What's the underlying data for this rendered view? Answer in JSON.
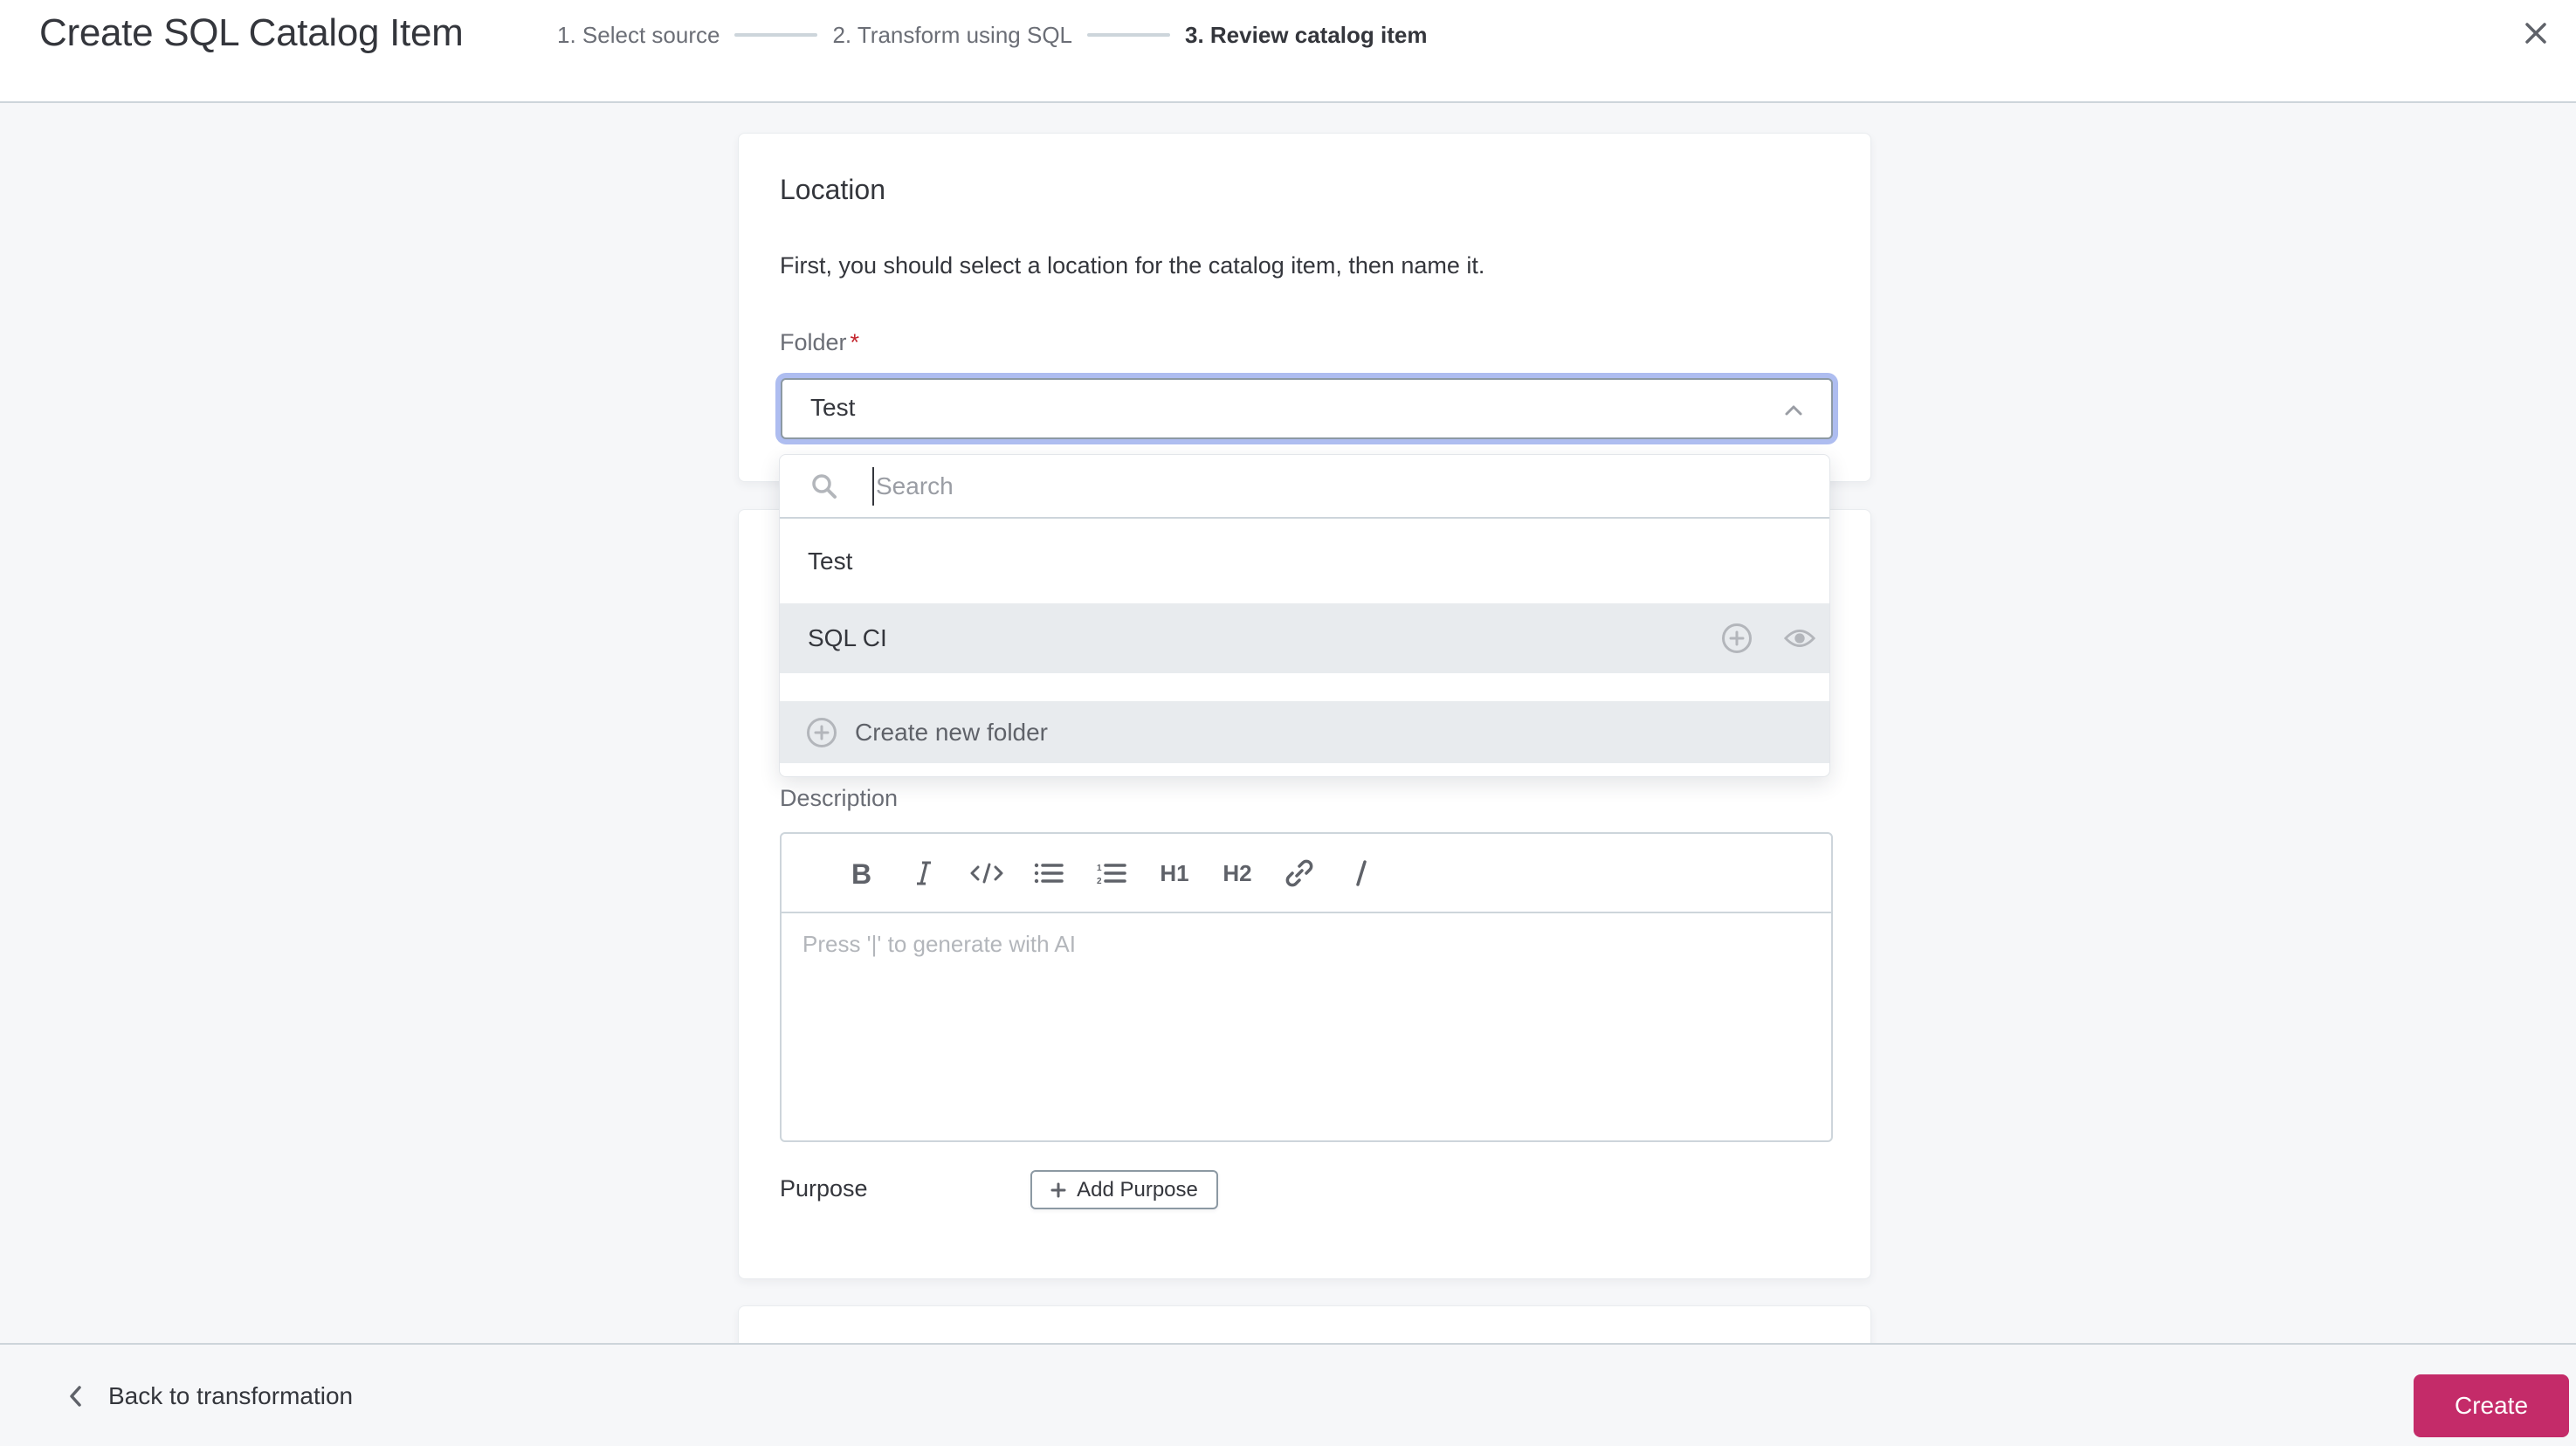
{
  "header": {
    "title": "Create SQL Catalog Item",
    "steps": [
      {
        "label": "1. Select source",
        "state": "completed"
      },
      {
        "label": "2. Transform using SQL",
        "state": "completed"
      },
      {
        "label": "3. Review catalog item",
        "state": "active"
      }
    ],
    "close_icon": "close-icon"
  },
  "location": {
    "title": "Location",
    "description": "First, you should select a location for the catalog item, then name it.",
    "folder_label": "Folder",
    "required_mark": "*",
    "folder_value": "Test",
    "dropdown": {
      "search_placeholder": "Search",
      "search_value": "",
      "items": [
        {
          "label": "Test",
          "highlighted": false
        },
        {
          "label": "SQL CI",
          "highlighted": true,
          "actions": [
            "add-subfolder-icon",
            "preview-eye-icon"
          ]
        }
      ],
      "create_label": "Create new folder"
    }
  },
  "details": {
    "description_label": "Description",
    "toolbar": [
      "bold",
      "italic",
      "code",
      "bullet-list",
      "numbered-list",
      "H1",
      "H2",
      "link",
      "ai-slash"
    ],
    "h1_label": "H1",
    "h2_label": "H2",
    "editor_placeholder": "Press '|' to generate with AI",
    "purpose_label": "Purpose",
    "add_purpose_label": "Add Purpose"
  },
  "footer": {
    "back_label": "Back to transformation",
    "create_label": "Create"
  },
  "colors": {
    "primary": "#c42b69",
    "focus_ring": "#aebdf0",
    "required": "#c4262e",
    "highlight": "#e8ebee"
  }
}
